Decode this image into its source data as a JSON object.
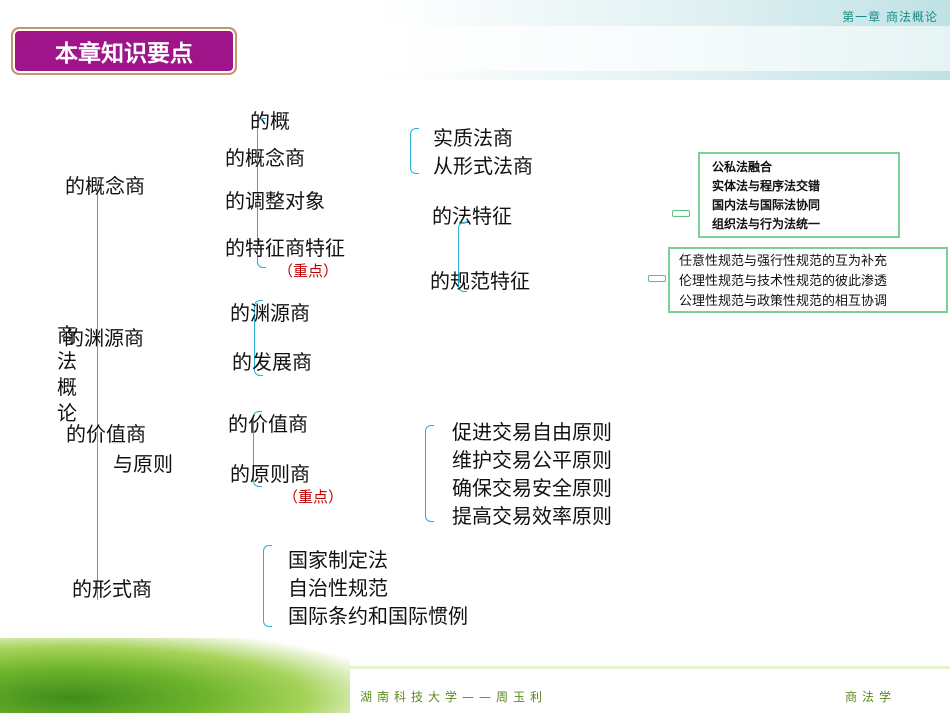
{
  "header": {
    "chapter": "第一章 商法概论",
    "title": "本章知识要点"
  },
  "root": {
    "title_chars": [
      "商",
      "法",
      "概",
      "论"
    ]
  },
  "level1": {
    "concept": "的概念商",
    "source": "的渊源商",
    "value": "的价值商",
    "principle_tail": "与原则",
    "form": "的形式商"
  },
  "concept": {
    "top": "的概",
    "definition": "的概念商",
    "object": "的调整对象",
    "features": "的特征商特征",
    "key": "（重点）"
  },
  "definition_sub": {
    "substantive": "实质法商",
    "formal": "从形式法商"
  },
  "features_sub": {
    "legal": "的法特征",
    "norm": "的规范特征"
  },
  "legal_box": [
    "公私法融合",
    "实体法与程序法交错",
    "国内法与国际法协同",
    "组织法与行为法统一"
  ],
  "norm_box": [
    "任意性规范与强行性规范的互为补充",
    "伦理性规范与技术性规范的彼此渗透",
    "公理性规范与政策性规范的相互协调"
  ],
  "source": {
    "origin": "的渊源商",
    "development": "的发展商"
  },
  "value": {
    "value": "的价值商",
    "principle": "的原则商",
    "key": "（重点）"
  },
  "principles": [
    "促进交易自由原则",
    "维护交易公平原则",
    "确保交易安全原则",
    "提高交易效率原则"
  ],
  "forms": [
    "国家制定法",
    "自治性规范",
    "国际条约和国际惯例"
  ],
  "footer": {
    "school": "湖南科技大学——周玉利",
    "course": "商法学"
  }
}
